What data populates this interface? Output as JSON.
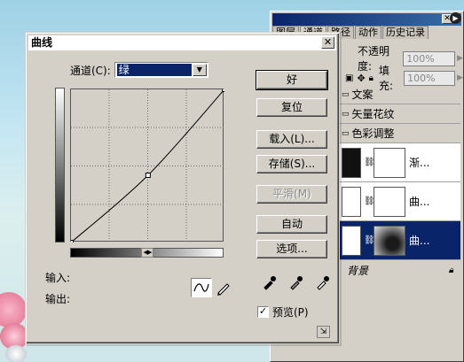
{
  "layers_panel": {
    "tabs": [
      "图层",
      "通道",
      "路径",
      "动作",
      "历史记录"
    ],
    "opacity_label": "不透明度:",
    "opacity_value": "100%",
    "fill_label": "填充:",
    "fill_value": "100%",
    "groups": [
      "文案",
      "矢量花纹",
      "色彩调整"
    ],
    "layers": [
      {
        "name": "渐..."
      },
      {
        "name": "曲..."
      },
      {
        "name": "曲..."
      }
    ],
    "background_layer": "背景"
  },
  "dialog": {
    "title": "曲线",
    "channel_label": "通道(C):",
    "channel_value": "绿",
    "input_label": "输入:",
    "output_label": "输出:",
    "buttons": {
      "ok": "好",
      "reset": "复位",
      "load": "载入(L)...",
      "save": "存储(S)...",
      "smooth": "平滑(M)",
      "auto": "自动",
      "options": "选项..."
    },
    "preview_label": "预览(P)",
    "preview_checked": true
  },
  "curve": {
    "channel": "green",
    "points": [
      [
        0,
        0
      ],
      [
        128,
        112
      ],
      [
        255,
        255
      ]
    ]
  },
  "colors": {
    "accent": "#0a246a",
    "dialog_bg": "#d4d0c8",
    "selection": "#0a246a"
  }
}
